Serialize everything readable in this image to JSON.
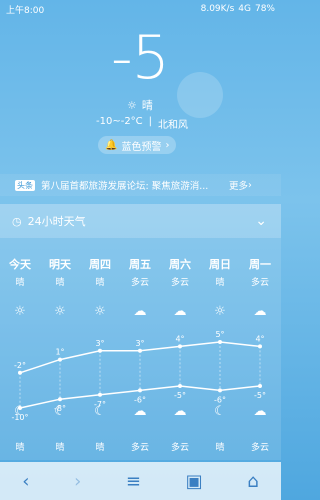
{
  "status_bar": {
    "time": "上午8:00",
    "speed": "8.09K/s",
    "network": "4G",
    "battery": "78%"
  },
  "hero": {
    "temp": "-5",
    "condition": "晴",
    "range": "-10~-2°C",
    "wind": "北和风",
    "warning": "蓝色预警"
  },
  "news": {
    "badge": "头条",
    "text": "第八届首都旅游发展论坛: 聚焦旅游消...",
    "more": "更多"
  },
  "forecast": {
    "title": "24小时天气",
    "days": [
      {
        "name": "今天",
        "day_cond": "晴",
        "night_cond": "晴",
        "hi": -2,
        "lo": -10
      },
      {
        "name": "明天",
        "day_cond": "晴",
        "night_cond": "晴",
        "hi": 1,
        "lo": -8
      },
      {
        "name": "周四",
        "day_cond": "晴",
        "night_cond": "晴",
        "hi": 3,
        "lo": -7
      },
      {
        "name": "周五",
        "day_cond": "多云",
        "night_cond": "多云",
        "hi": 3,
        "lo": -6
      },
      {
        "name": "周六",
        "day_cond": "多云",
        "night_cond": "多云",
        "hi": 4,
        "lo": -5
      },
      {
        "name": "周日",
        "day_cond": "晴",
        "night_cond": "晴",
        "hi": 5,
        "lo": -6
      },
      {
        "name": "周一",
        "day_cond": "多云",
        "night_cond": "多云",
        "hi": 4,
        "lo": -5
      }
    ]
  },
  "chart_data": {
    "type": "line",
    "categories": [
      "今天",
      "明天",
      "周四",
      "周五",
      "周六",
      "周日",
      "周一"
    ],
    "series": [
      {
        "values": [
          -2,
          1,
          3,
          3,
          4,
          5,
          4
        ]
      },
      {
        "values": [
          -10,
          -8,
          -7,
          -6,
          -5,
          -6,
          -5
        ]
      }
    ],
    "ylim": [
      -10,
      5
    ]
  }
}
